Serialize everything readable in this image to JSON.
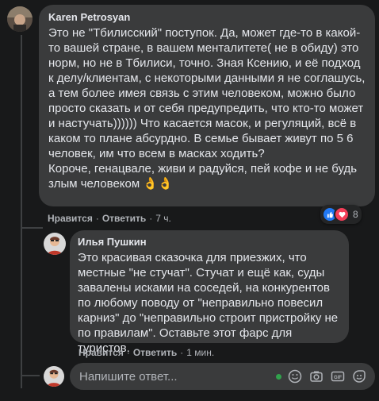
{
  "comment": {
    "author": "Karen Petrosyan",
    "text": "Это не \"Тбилисский\" поступок. Да, может где-то в какой-то вашей стране, в вашем менталитете( не в обиду) это норм, но не в Тбилиси, точно. Зная Ксению, и её подход к делу/клиентам, с некоторыми данными я не соглашусь, а тем более имея связь с этим человеком, можно было просто сказать и от себя предупредить, что кто-то может и настучать)))))) Что касается масок, и регуляций, всё в каком то плане абсурдно. В семье бывает живут по 5 6 человек, им что всем в масках ходить?\nКороче, генацвале, живи и радуйся, пей кофе и не будь злым человеком 👌👌",
    "like": "Нравится",
    "reply": "Ответить",
    "time": "7 ч.",
    "reaction_count": "8"
  },
  "reply": {
    "author": "Илья Пушкин",
    "text": "Это красивая сказочка для приезжих, что местные \"не стучат\". Стучат и ещё как, суды завалены исками на соседей, на конкурентов по любому поводу от \"неправильно повесил карниз\" до \"неправильно строит пристройку не по правилам\". Оставьте этот фарс для туристов.",
    "like": "Нравится",
    "reply": "Ответить",
    "time": "1 мин."
  },
  "composer": {
    "placeholder": "Напишите ответ..."
  },
  "colors": {
    "background": "#18191a",
    "bubble": "#3a3b3c",
    "text": "#e4e6eb",
    "secondary": "#b0b3b8",
    "like_blue": "#2078f4",
    "love_red": "#f33e58",
    "online_green": "#31a24c"
  },
  "icons": [
    "like-icon",
    "love-icon",
    "emoji-icon",
    "camera-icon",
    "gif-icon",
    "sticker-icon",
    "online-dot-icon"
  ]
}
